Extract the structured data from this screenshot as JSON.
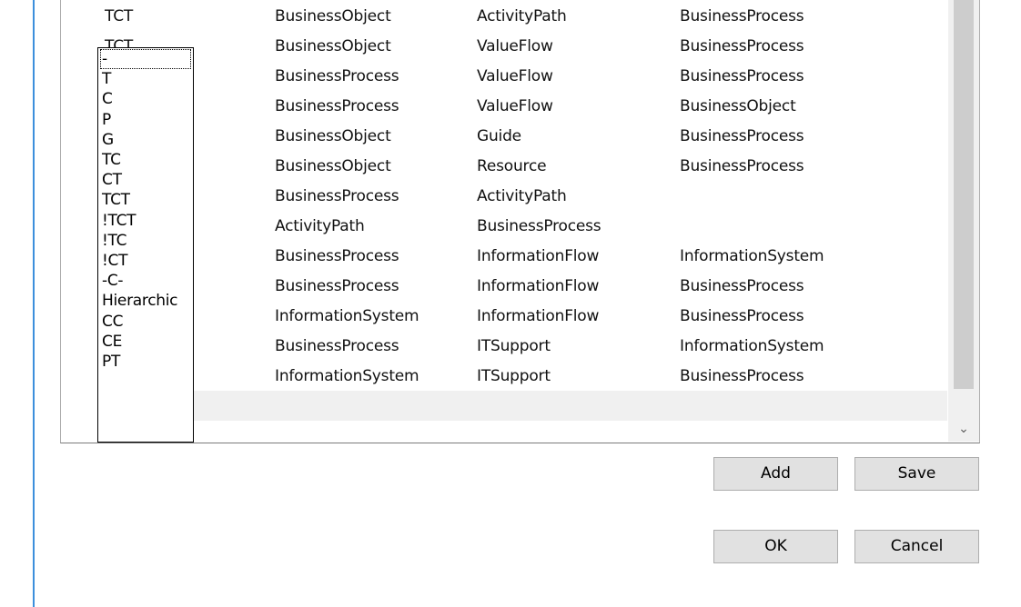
{
  "grid": {
    "rows": [
      [
        "TCT",
        "BusinessObject",
        "ActivityPath",
        "BusinessProcess"
      ],
      [
        "TCT",
        "BusinessObject",
        "ValueFlow",
        "BusinessProcess"
      ],
      [
        "",
        "BusinessProcess",
        "ValueFlow",
        "BusinessProcess"
      ],
      [
        "",
        "BusinessProcess",
        "ValueFlow",
        "BusinessObject"
      ],
      [
        "",
        "BusinessObject",
        "Guide",
        "BusinessProcess"
      ],
      [
        "",
        "BusinessObject",
        "Resource",
        "BusinessProcess"
      ],
      [
        "",
        "BusinessProcess",
        "ActivityPath",
        ""
      ],
      [
        "",
        "ActivityPath",
        "BusinessProcess",
        ""
      ],
      [
        "",
        "BusinessProcess",
        "InformationFlow",
        "InformationSystem"
      ],
      [
        "",
        "BusinessProcess",
        "InformationFlow",
        "BusinessProcess"
      ],
      [
        "",
        "InformationSystem",
        "InformationFlow",
        "BusinessProcess"
      ],
      [
        "",
        "BusinessProcess",
        "ITSupport",
        "InformationSystem"
      ],
      [
        "",
        "InformationSystem",
        "ITSupport",
        "BusinessProcess"
      ]
    ]
  },
  "dropdown": {
    "options": [
      "-",
      "T",
      "C",
      "P",
      "G",
      "TC",
      "CT",
      "TCT",
      "!TCT",
      "!TC",
      "!CT",
      "-C-",
      "Hierarchic",
      "CC",
      "CE",
      "PT"
    ],
    "focused_index": 0
  },
  "scrollbar": {
    "down_arrow": "⌄"
  },
  "buttons": {
    "add": "Add",
    "save": "Save",
    "ok": "OK",
    "cancel": "Cancel"
  }
}
